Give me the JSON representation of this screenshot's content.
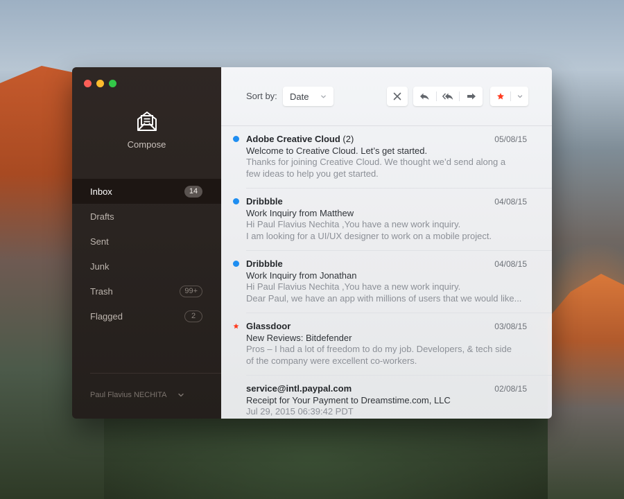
{
  "sidebar": {
    "compose_label": "Compose",
    "items": [
      {
        "key": "inbox",
        "label": "Inbox",
        "badge": "14",
        "badge_style": "filled",
        "active": true
      },
      {
        "key": "drafts",
        "label": "Drafts",
        "badge": "",
        "badge_style": "",
        "active": false
      },
      {
        "key": "sent",
        "label": "Sent",
        "badge": "",
        "badge_style": "",
        "active": false
      },
      {
        "key": "junk",
        "label": "Junk",
        "badge": "",
        "badge_style": "",
        "active": false
      },
      {
        "key": "trash",
        "label": "Trash",
        "badge": "99+",
        "badge_style": "outline",
        "active": false
      },
      {
        "key": "flagged",
        "label": "Flagged",
        "badge": "2",
        "badge_style": "outline",
        "active": false
      }
    ],
    "user_name": "Paul Flavius NECHITA"
  },
  "toolbar": {
    "sort_label": "Sort by:",
    "sort_value": "Date"
  },
  "colors": {
    "unread": "#1f8ef1",
    "flag": "#ff3b1f",
    "sidebar_bg": "#2a2421"
  },
  "icons": {
    "compose": "envelope-open-icon",
    "close": "close-icon",
    "reply": "reply-icon",
    "reply_all": "reply-all-icon",
    "forward": "forward-icon",
    "flag": "star-icon"
  },
  "messages": [
    {
      "sender": "Adobe Creative Cloud",
      "count": "(2)",
      "date": "05/08/15",
      "subject": "Welcome to Creative Cloud. Let’s get started.",
      "preview": [
        "Thanks for joining Creative Cloud. We thought we’d send along a",
        "few ideas to help you get started."
      ],
      "status": "unread"
    },
    {
      "sender": "Dribbble",
      "count": "",
      "date": "04/08/15",
      "subject": "Work Inquiry from Matthew",
      "preview": [
        "Hi Paul Flavius Nechita ,You have a new work inquiry.",
        "I am looking for a UI/UX designer to work on a mobile project."
      ],
      "status": "unread"
    },
    {
      "sender": "Dribbble",
      "count": "",
      "date": "04/08/15",
      "subject": "Work Inquiry from Jonathan",
      "preview": [
        "Hi Paul Flavius Nechita ,You have a new work inquiry.",
        "Dear Paul, we have an app with millions of users that we would like..."
      ],
      "status": "unread"
    },
    {
      "sender": "Glassdoor",
      "count": "",
      "date": "03/08/15",
      "subject": "New Reviews: Bitdefender",
      "preview": [
        "Pros – I had a lot of freedom to do my job. Developers, & tech side",
        "of the company were excellent co-workers."
      ],
      "status": "flagged"
    },
    {
      "sender": "service@intl.paypal.com",
      "count": "",
      "date": "02/08/15",
      "subject": "Receipt for Your Payment to Dreamstime.com, LLC",
      "preview": [
        "Jul 29, 2015 06:39:42 PDT"
      ],
      "status": "read"
    }
  ]
}
